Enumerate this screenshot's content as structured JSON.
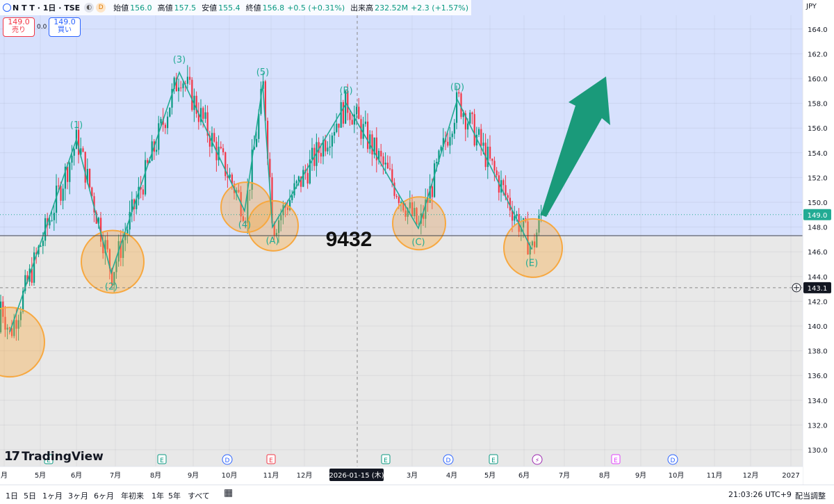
{
  "header": {
    "symbol": "N T T · 1日 · TSE",
    "mode_badge": "D",
    "open_label": "始値",
    "open": "156.0",
    "high_label": "高値",
    "high": "157.5",
    "low_label": "安値",
    "low": "155.4",
    "close_label": "終値",
    "close": "156.8",
    "change": "+0.5 (+0.31%)",
    "volume_label": "出来高",
    "volume": "232.52M",
    "volume_change": "+2.3 (+1.57%)"
  },
  "quotes": {
    "sell_price": "149.0",
    "sell_label": "売り",
    "spread": "0.0",
    "buy_price": "149.0",
    "buy_label": "買い"
  },
  "currency": "JPY",
  "chart_data": {
    "type": "candlestick",
    "watermark": "9432",
    "y_axis": {
      "ticks": [
        "130.0",
        "132.0",
        "134.0",
        "136.0",
        "138.0",
        "140.0",
        "142.0",
        "144.0",
        "146.0",
        "148.0",
        "150.0",
        "152.0",
        "154.0",
        "156.0",
        "158.0",
        "160.0",
        "162.0",
        "164.0"
      ],
      "range": [
        129.5,
        165.5
      ]
    },
    "x_axis": {
      "ticks": [
        "月",
        "5月",
        "6月",
        "7月",
        "8月",
        "9月",
        "10月",
        "11月",
        "12月",
        "3月",
        "4月",
        "5月",
        "6月",
        "7月",
        "8月",
        "9月",
        "10月",
        "11月",
        "12月",
        "2027"
      ],
      "crosshair_label": "2026-01-15 (木)"
    },
    "price_labels": {
      "last": "149.0",
      "crosshair": "143.1"
    },
    "horizontal_line": 147.3,
    "wave_labels": [
      {
        "label": "(1)",
        "value": 155.1
      },
      {
        "label": "(2)",
        "value": 144.3
      },
      {
        "label": "(3)",
        "value": 160.5
      },
      {
        "label": "(4)",
        "value": 149.3
      },
      {
        "label": "(5)",
        "value": 159.5
      },
      {
        "label": "(A)",
        "value": 148.0
      },
      {
        "label": "(B)",
        "value": 158.0
      },
      {
        "label": "(C)",
        "value": 147.9
      },
      {
        "label": "(D)",
        "value": 158.3
      },
      {
        "label": "(E)",
        "value": 146.2
      }
    ],
    "event_markers": [
      "E",
      "D",
      "E",
      "E",
      "D",
      "E",
      "⚡",
      "E",
      "D"
    ],
    "colors": {
      "up": "#089981",
      "down": "#f23645",
      "wave": "#22ab94",
      "arrow": "#1a9a7a",
      "circle": "#f7a840",
      "upper_band": "#d7e1fd",
      "lower_band": "#e8e8e8"
    }
  },
  "bottom": {
    "timeframes": [
      "1日",
      "5日",
      "1ヶ月",
      "3ヶ月",
      "6ヶ月",
      "年初来",
      "1年",
      "5年",
      "すべて"
    ],
    "clock": "21:03:26 UTC+9",
    "adjust": "配当調整"
  },
  "branding": "TradingView"
}
